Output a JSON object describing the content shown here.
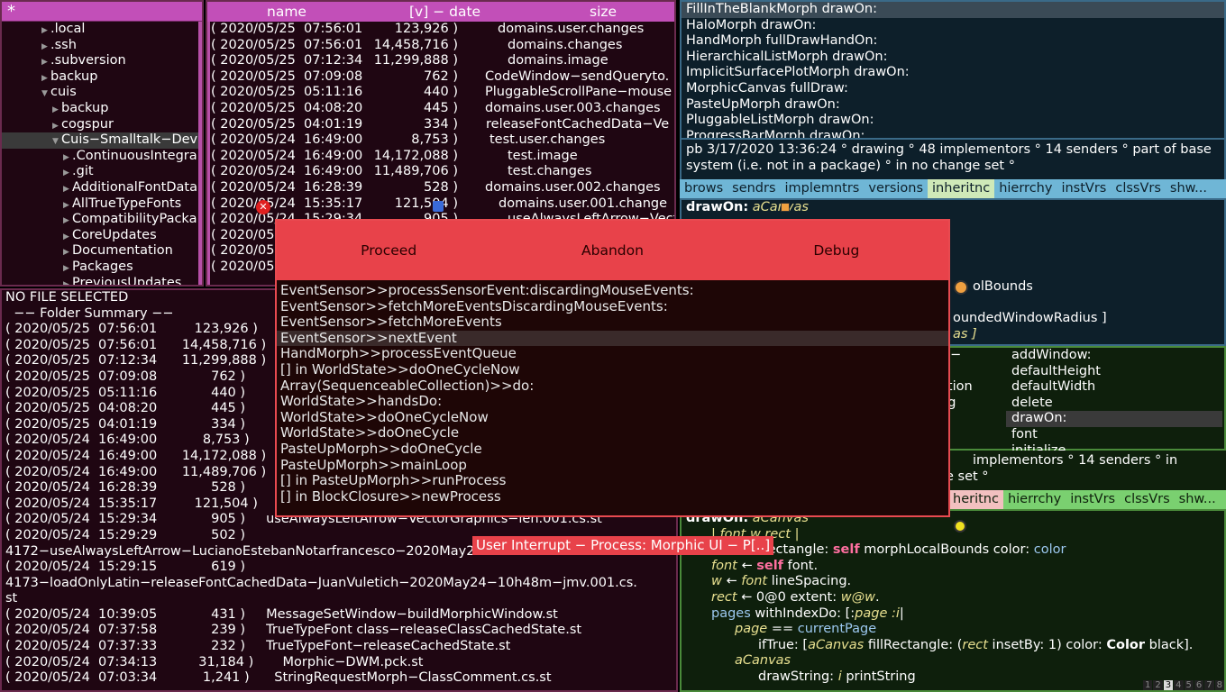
{
  "tree": {
    "header": "*",
    "items": [
      {
        "label": ".local",
        "indent": 56
      },
      {
        "label": ".ssh",
        "indent": 56
      },
      {
        "label": ".subversion",
        "indent": 56
      },
      {
        "label": "backup",
        "indent": 56
      },
      {
        "label": "cuis",
        "indent": 56
      },
      {
        "label": "backup",
        "indent": 68
      },
      {
        "label": "cogspur",
        "indent": 68
      },
      {
        "label": "Cuis−Smalltalk−Dev",
        "indent": 68
      },
      {
        "label": ".ContinuousIntegra",
        "indent": 80
      },
      {
        "label": ".git",
        "indent": 80
      },
      {
        "label": "AdditionalFontData",
        "indent": 80
      },
      {
        "label": "AllTrueTypeFonts",
        "indent": 80
      },
      {
        "label": "CompatibilityPacka",
        "indent": 80
      },
      {
        "label": "CoreUpdates",
        "indent": 80
      },
      {
        "label": "Documentation",
        "indent": 80
      },
      {
        "label": "Packages",
        "indent": 80
      },
      {
        "label": "PreviousUpdates",
        "indent": 80
      }
    ]
  },
  "files": {
    "col_name": "name",
    "col_date": "[v] − date",
    "col_size": "size",
    "rows": [
      {
        "date": "( 2020/05/25  07:56:01",
        "size": "123,926 )",
        "name": "domains.user.changes"
      },
      {
        "date": "( 2020/05/25  07:56:01",
        "size": "14,458,716 )",
        "name": "domains.changes"
      },
      {
        "date": "( 2020/05/25  07:12:34",
        "size": "11,299,888 )",
        "name": "domains.image"
      },
      {
        "date": "( 2020/05/25  07:09:08",
        "size": "762 )",
        "name": "CodeWindow−sendQueryto."
      },
      {
        "date": "( 2020/05/25  05:11:16",
        "size": "440 )",
        "name": "PluggableScrollPane−mouse"
      },
      {
        "date": "( 2020/05/25  04:08:20",
        "size": "445 )",
        "name": "domains.user.003.changes"
      },
      {
        "date": "( 2020/05/25  04:01:19",
        "size": "334 )",
        "name": "releaseFontCachedData−Ve"
      },
      {
        "date": "( 2020/05/24  16:49:00",
        "size": "8,753 )",
        "name": "test.user.changes"
      },
      {
        "date": "( 2020/05/24  16:49:00",
        "size": "14,172,088 )",
        "name": "test.image"
      },
      {
        "date": "( 2020/05/24  16:49:00",
        "size": "11,489,706 )",
        "name": "test.changes"
      },
      {
        "date": "( 2020/05/24  16:28:39",
        "size": "528 )",
        "name": "domains.user.002.changes"
      },
      {
        "date": "( 2020/05/24  15:35:17",
        "size": "121,504 )",
        "name": "domains.user.001.change"
      },
      {
        "date": "( 2020/05/24  15:29:34",
        "size": "905 )",
        "name": "useAlwaysLeftArrow−Vector"
      },
      {
        "date": "( 2020/05",
        "size": "",
        "name": ""
      },
      {
        "date": "( 2020/05",
        "size": "",
        "name": ""
      },
      {
        "date": "( 2020/05",
        "size": "",
        "name": ""
      }
    ]
  },
  "summary": {
    "lines": [
      "NO FILE SELECTED",
      "  −− Folder Summary −−",
      "( 2020/05/25  07:56:01         123,926 )",
      "( 2020/05/25  07:56:01      14,458,716 )",
      "( 2020/05/25  07:12:34      11,299,888 )",
      "( 2020/05/25  07:09:08             762 )",
      "( 2020/05/25  05:11:16             440 )",
      "( 2020/05/25  04:08:20             445 )",
      "( 2020/05/25  04:01:19             334 )",
      "( 2020/05/24  16:49:00           8,753 )",
      "( 2020/05/24  16:49:00      14,172,088 )",
      "( 2020/05/24  16:49:00      11,489,706 )",
      "( 2020/05/24  16:28:39             528 )",
      "( 2020/05/24  15:35:17         121,504 )",
      "( 2020/05/24  15:29:34             905 )     useAlwaysLeftArrow−VectorGraphics−len.001.cs.st",
      "( 2020/05/24  15:29:29             502 )",
      "4172−useAlwaysLeftArrow−LucianoEstebanNotarfrancesco−2020May2",
      "( 2020/05/24  15:29:15             619 )",
      "4173−loadOnlyLatin−releaseFontCachedData−JuanVuletich−2020May24−10h48m−jmv.001.cs.",
      "st",
      "( 2020/05/24  10:39:05             431 )     MessageSetWindow−buildMorphicWindow.st",
      "( 2020/05/24  07:37:58             239 )     TrueTypeFont class−releaseClassCachedState.st",
      "( 2020/05/24  07:37:33             232 )     TrueTypeFont−releaseCachedState.st",
      "( 2020/05/24  07:34:13          31,184 )       Morphic−DWM.pck.st",
      "( 2020/05/24  07:03:34           1,241 )      StringRequestMorph−ClassComment.cs.st"
    ]
  },
  "senders": {
    "items": [
      "FillInTheBlankMorph drawOn:",
      "HaloMorph drawOn:",
      "HandMorph fullDrawHandOn:",
      "HierarchicalListMorph drawOn:",
      "ImplicitSurfacePlotMorph drawOn:",
      "MorphicCanvas fullDraw:",
      "PasteUpMorph drawOn:",
      "PluggableListMorph drawOn:",
      "ProgressBarMorph drawOn:"
    ]
  },
  "info_a": "pb 3/17/2020 13:36:24 ° drawing ° 48 implementors ° 14 senders ° part of base system (i.e. not in a package) ° in no change set °",
  "toolbar_a": [
    "brows",
    "sendrs",
    "implemntrs",
    "versions",
    "inheritnc",
    "hierrchy",
    "instVrs",
    "clssVrs",
    "shw..."
  ],
  "code_a": {
    "selector": "drawOn:",
    "arg": "aCanvas",
    "frag1": "ers",
    "frag2": "olBounds",
    "frag3": "oundedWindowRadius ]",
    "frag4": "as ]"
  },
  "mid": {
    "frag_lines": [
      "−−",
      "g",
      "ation",
      "ng"
    ],
    "methods": [
      "addWindow:",
      "defaultHeight",
      "defaultWidth",
      "delete",
      "drawOn:",
      "font",
      "initialize"
    ]
  },
  "info_b": [
    " implementors ° 14 senders ° in",
    "e set °"
  ],
  "toolbar_b": [
    "heritnc",
    "hierrchy",
    "instVrs",
    "clssVrs",
    "shw..."
  ],
  "code_b": {
    "l1_sel": "drawOn:",
    "l1_arg": "aCanvas",
    "l2": "| font w rect |",
    "l3_a": "fillRectangle:",
    "l3_self": "self",
    "l3_b": "morphLocalBounds color:",
    "l3_c": "color",
    "l4_var": "font",
    "l4_arrow": "←",
    "l4_self": "self",
    "l4_rest": "font.",
    "l5_var": "w",
    "l5_arrow": "←",
    "l5_font": "font",
    "l5_rest": "lineSpacing.",
    "l6_var": "rect",
    "l6_arrow": "←",
    "l6_a": "0@0 extent:",
    "l6_w": "w@w",
    "l7_a": "pages",
    "l7_b": "withIndexDo: [:",
    "l7_c": "page :i",
    "l8_a": "page",
    "l8_b": "==",
    "l8_c": "currentPage",
    "l9_a": "ifTrue: [",
    "l9_b": "aCanvas",
    "l9_c": "fillRectangle: (",
    "l9_d": "rect",
    "l9_e": "insetBy: 1) color:",
    "l9_f": "Color",
    "l9_g": "black].",
    "l10": "aCanvas",
    "l11_a": "drawString:",
    "l11_b": "i",
    "l11_c": "printString"
  },
  "debugger": {
    "buttons": [
      "Proceed",
      "Abandon",
      "Debug"
    ],
    "stack": [
      "EventSensor>>processSensorEvent:discardingMouseEvents:",
      "EventSensor>>fetchMoreEventsDiscardingMouseEvents:",
      "EventSensor>>fetchMoreEvents",
      "EventSensor>>nextEvent",
      "HandMorph>>processEventQueue",
      "[] in WorldState>>doOneCycleNow",
      "Array(SequenceableCollection)>>do:",
      "WorldState>>handsDo:",
      "WorldState>>doOneCycleNow",
      "WorldState>>doOneCycle",
      "PasteUpMorph>>doOneCycle",
      "PasteUpMorph>>mainLoop",
      "[] in PasteUpMorph>>runProcess",
      "[] in BlockClosure>>newProcess"
    ],
    "title": "User Interrupt − Process: Morphic UI − P[..]"
  },
  "desktops": [
    "1",
    "2",
    "3",
    "4",
    "5",
    "6",
    "7",
    "8"
  ]
}
